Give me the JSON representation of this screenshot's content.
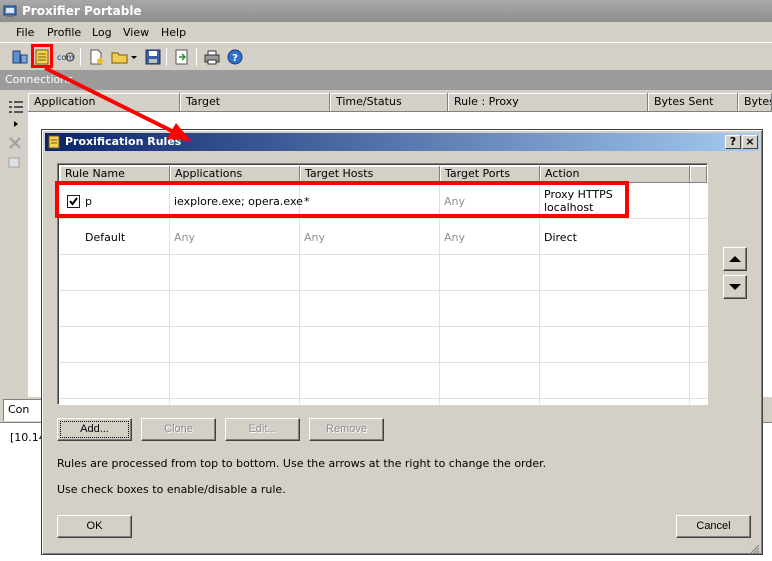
{
  "window": {
    "title": "Proxifier Portable"
  },
  "menu": [
    "File",
    "Profile",
    "Log",
    "View",
    "Help"
  ],
  "toolbar": {
    "icons": [
      "proxy-servers-icon",
      "proxification-rules-icon",
      "name-resolution-icon",
      "new-profile-icon",
      "open-profile-icon",
      "save-profile-icon",
      "export-icon",
      "print-icon",
      "help-icon"
    ]
  },
  "connections": {
    "label": "Connections",
    "columns": [
      "Application",
      "Target",
      "Time/Status",
      "Rule : Proxy",
      "Bytes Sent",
      "Bytes"
    ]
  },
  "bottom_tab": {
    "label": "Con"
  },
  "log": {
    "line": "[10.14"
  },
  "dialog": {
    "title": "Proxification Rules",
    "help_button": "?",
    "close_button": "×",
    "columns": [
      "Rule Name",
      "Applications",
      "Target Hosts",
      "Target Ports",
      "Action"
    ],
    "rules": [
      {
        "checked": true,
        "name": "p",
        "applications": "iexplore.exe; opera.exe",
        "hosts": "*",
        "ports": "Any",
        "action_line1": "Proxy HTTPS",
        "action_line2": "localhost"
      },
      {
        "checked": false,
        "name": "Default",
        "applications": "Any",
        "hosts": "Any",
        "ports": "Any",
        "action": "Direct"
      }
    ],
    "buttons": {
      "add": "Add...",
      "clone": "Clone",
      "edit": "Edit...",
      "remove": "Remove",
      "ok": "OK",
      "cancel": "Cancel"
    },
    "info_line1": "Rules are processed from top to bottom. Use the arrows at the right to change the order.",
    "info_line2": "Use check boxes to enable/disable a rule."
  },
  "colors": {
    "annotation": "#ff0000",
    "title_active_start": "#0a246a",
    "title_active_end": "#a6caf0"
  }
}
